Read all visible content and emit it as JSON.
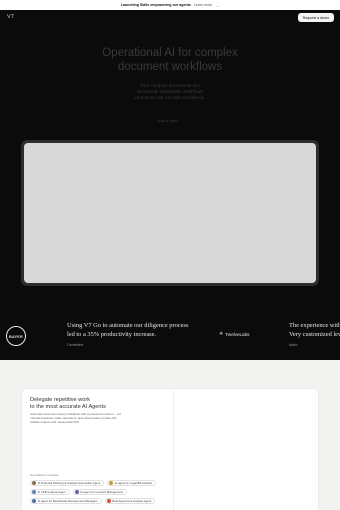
{
  "announcement": {
    "text": "Launching Skills empowering our agents",
    "link_label": "Learn more",
    "arrow": "→"
  },
  "nav": {
    "logo": "V7",
    "cta_label": "Request a demo"
  },
  "hero": {
    "title_line1": "Operational AI for complex",
    "title_line2": "document workflows",
    "subtitle_line1": "Turn complex documents into",
    "subtitle_line2": "structured, repeatable workflows",
    "subtitle_line3": "your team can run with confidence.",
    "link_label": "Book a demo →"
  },
  "testimonials": [
    {
      "logo_text": "BAYER",
      "quote_line1": "Using V7 Go to automate our diligence process",
      "quote_line2": "led to a 35% productivity increase.",
      "author": "Centerline"
    },
    {
      "logo_text": "TwelveLabs",
      "quote_line1": "The experience with",
      "quote_line2": "Very customized lev",
      "author": "Astro"
    }
  ],
  "features": {
    "title_line1": "Delegate repetitive work",
    "title_line2": "to the most accurate AI Agents",
    "desc_line1": "Automate document-heavy workflows with connected precision – cut",
    "desc_line2": "manual workload, scale operations, and unlock faster results with",
    "desc_line3": "reliable outputs and measurable ROI.",
    "agents_label": "Get started in minutes",
    "chips": [
      {
        "label": "AI Financial Planning & Analysis Automation Agent",
        "color": "#8a6b4f"
      },
      {
        "label": "AI agent for Legal Bill Analysis",
        "color": "#c89a3a"
      },
      {
        "label": "AI CPE Analysis Agent",
        "color": "#5a7fb5"
      },
      {
        "label": "AI agent for Contract Management",
        "color": "#6b5fa8"
      },
      {
        "label": "AI agent for Real Estate Development Managers",
        "color": "#4f6fa0"
      },
      {
        "label": "Deal Agreement Analysis Agent",
        "color": "#d2553f"
      }
    ]
  }
}
